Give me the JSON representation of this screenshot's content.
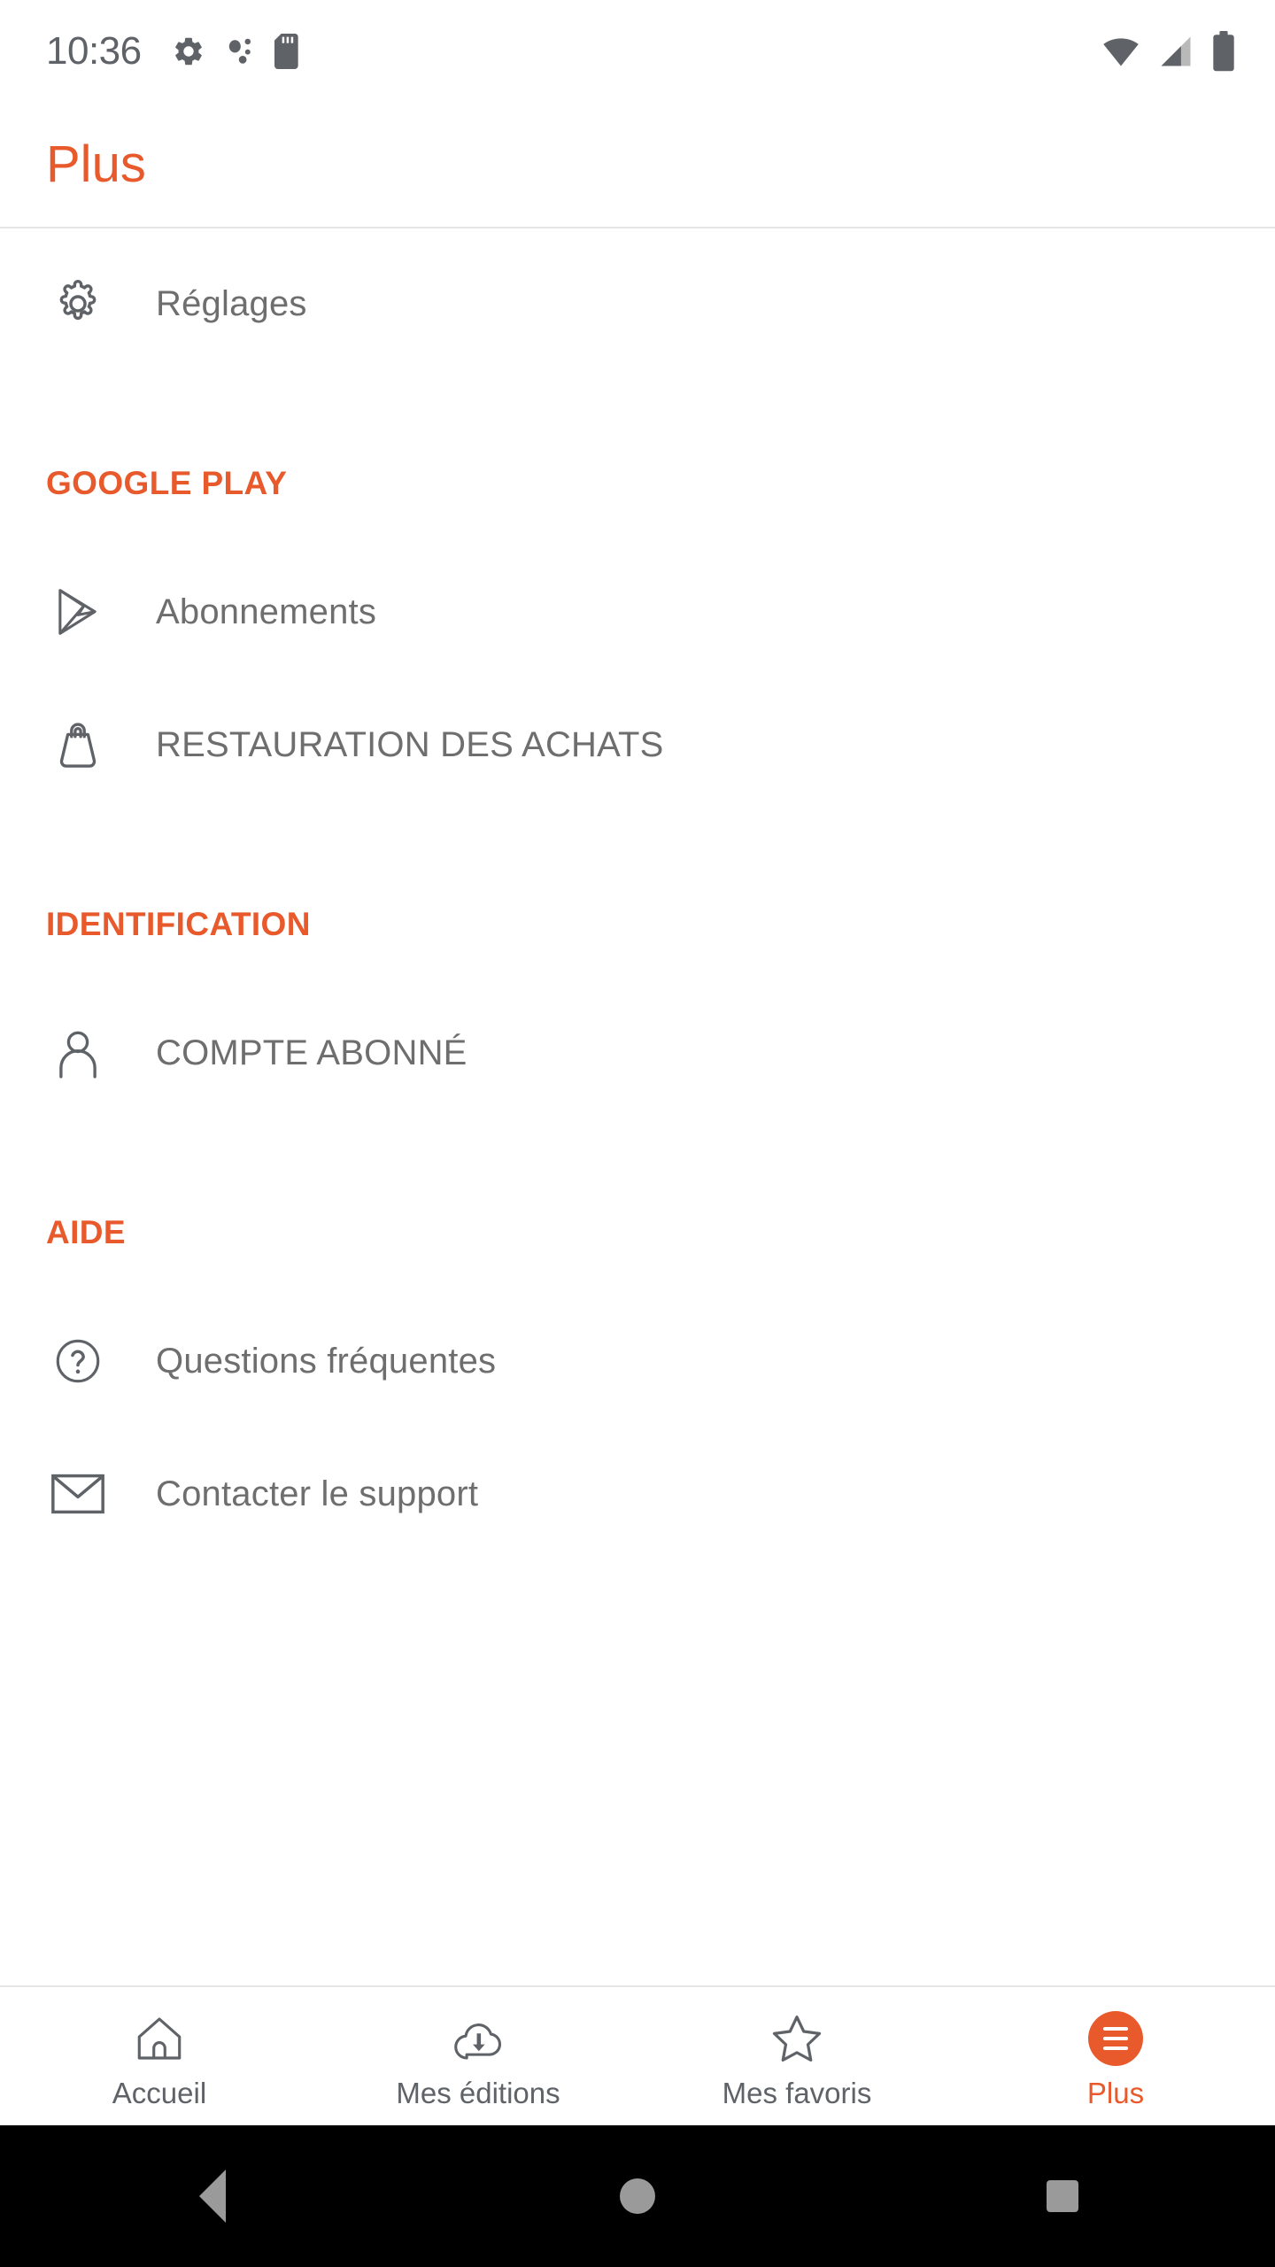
{
  "status_bar": {
    "clock": "10:36",
    "left_icons": [
      "gear-icon",
      "dots-icon",
      "sd-card-icon"
    ],
    "right_icons": [
      "wifi-icon",
      "cellular-signal-icon",
      "battery-icon"
    ]
  },
  "header": {
    "title": "Plus"
  },
  "menu": {
    "top_items": [
      {
        "icon": "gear-icon",
        "label": "Réglages"
      }
    ],
    "sections": [
      {
        "title": "GOOGLE PLAY",
        "items": [
          {
            "icon": "google-play-icon",
            "label": "Abonnements"
          },
          {
            "icon": "shopping-bag-icon",
            "label": "RESTAURATION DES ACHATS"
          }
        ]
      },
      {
        "title": "IDENTIFICATION",
        "items": [
          {
            "icon": "person-icon",
            "label": "COMPTE ABONNÉ"
          }
        ]
      },
      {
        "title": "AIDE",
        "items": [
          {
            "icon": "question-circle-icon",
            "label": "Questions fréquentes"
          },
          {
            "icon": "envelope-icon",
            "label": "Contacter le support"
          }
        ]
      }
    ]
  },
  "bottom_nav": {
    "items": [
      {
        "icon": "home-icon",
        "label": "Accueil",
        "active": false
      },
      {
        "icon": "cloud-download-icon",
        "label": "Mes éditions",
        "active": false
      },
      {
        "icon": "star-icon",
        "label": "Mes favoris",
        "active": false
      },
      {
        "icon": "hamburger-menu-icon",
        "label": "Plus",
        "active": true
      }
    ]
  },
  "system_nav": {
    "back": "back-triangle-icon",
    "home": "home-circle-icon",
    "recents": "recents-square-icon"
  },
  "colors": {
    "accent": "#e8592b",
    "text_secondary": "#6e6e6e",
    "icon_stroke": "#5f6368",
    "divider": "#e6e6e6",
    "system_nav_bg": "#000000"
  }
}
